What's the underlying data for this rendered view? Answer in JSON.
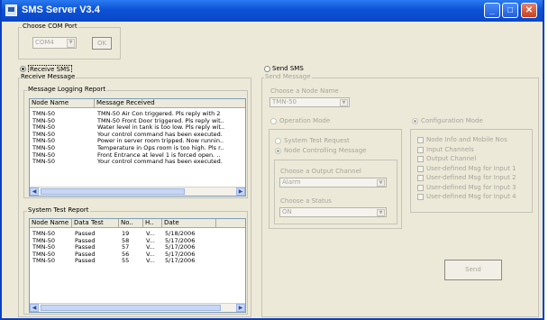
{
  "window": {
    "title": "SMS Server V3.4",
    "min": "_",
    "max": "□",
    "close": "✕"
  },
  "com_port": {
    "legend": "Choose COM Port",
    "value": "COM4",
    "ok": "OK"
  },
  "receive_sms": {
    "label": "Receive SMS",
    "legend": "Receive Message"
  },
  "log_report": {
    "legend": "Message Logging Report",
    "columns": [
      "Node Name",
      "Message Received"
    ],
    "rows": [
      [
        "TMN-50",
        "TMN-50 Air Con triggered. Pls reply with 2"
      ],
      [
        "TMN-50",
        "TMN-50 Front Door triggered. Pls reply wit.."
      ],
      [
        "TMN-50",
        "Water level in tank is too low. Pls reply wit.."
      ],
      [
        "TMN-50",
        "Your control command has been executed."
      ],
      [
        "TMN-50",
        "Power in server room tripped. Now runnin.."
      ],
      [
        "TMN-50",
        "Temperature in Ops room is too high. Pls r.."
      ],
      [
        "TMN-50",
        "Front Entrance at level 1 is forced open. .."
      ],
      [
        "TMN-50",
        "Your control command has been executed."
      ]
    ]
  },
  "system_test": {
    "legend": "System Test Report",
    "columns": [
      "Node Name",
      "Data Test",
      "No..",
      "H..",
      "Date"
    ],
    "rows": [
      [
        "TMN-50",
        "Passed",
        "19",
        "V...",
        "5/18/2006"
      ],
      [
        "TMN-50",
        "Passed",
        "58",
        "V...",
        "5/17/2006"
      ],
      [
        "TMN-50",
        "Passed",
        "57",
        "V...",
        "5/17/2006"
      ],
      [
        "TMN-50",
        "Passed",
        "56",
        "V...",
        "5/17/2006"
      ],
      [
        "TMN-50",
        "Passed",
        "55",
        "V...",
        "5/17/2006"
      ]
    ]
  },
  "send_sms": {
    "label": "Send SMS",
    "legend": "Send Message",
    "node_label": "Choose a Node Name",
    "node_value": "TMN-50",
    "operation_mode": "Operation Mode",
    "configuration_mode": "Configuration Mode",
    "system_test_request": "System Test Request",
    "node_controlling": "Node Controlling Message",
    "output_channel_label": "Choose a Output Channel",
    "output_channel_value": "Alarm",
    "status_label": "Choose a Status",
    "status_value": "ON",
    "config_options": [
      "Node Info and Mobile Nos",
      "Input Channels",
      "Output Channel",
      "User-defined Msg for Input 1",
      "User-defined Msg for Input 2",
      "User-defined Msg for Input 3",
      "User-defined Msg for Input 4"
    ],
    "send_button": "Send"
  }
}
